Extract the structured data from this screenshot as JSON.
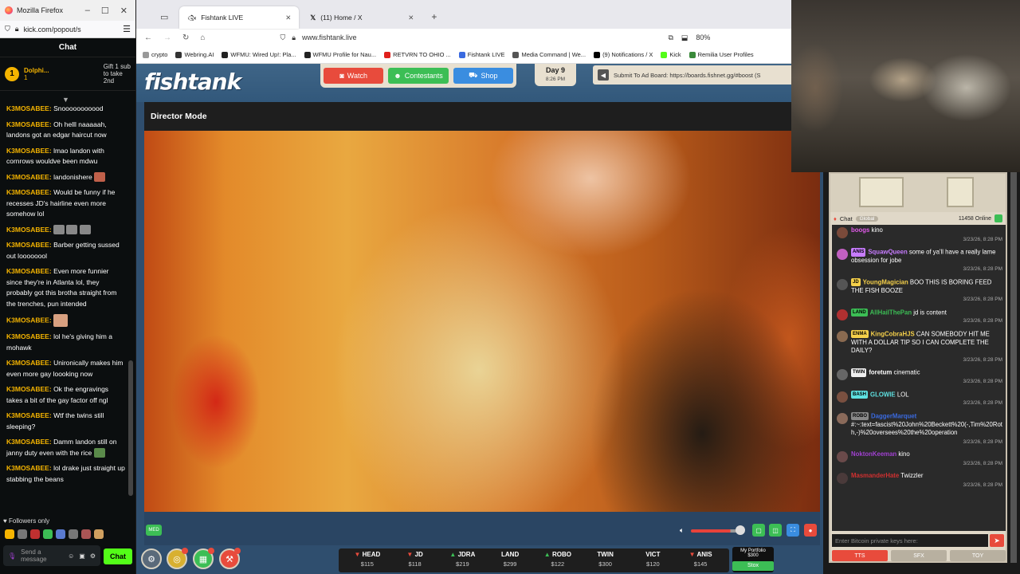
{
  "kick": {
    "window_title": "Mozilla Firefox",
    "url": "kick.com/popout/s",
    "chat_title": "Chat",
    "pinned": {
      "user": "Dolphi...",
      "rank": "1",
      "count": "1",
      "gift_line1": "Gift 1 sub",
      "gift_line2": "to take",
      "gift_line3": "2nd"
    },
    "messages": [
      {
        "user": "K3MOSABEE:",
        "text": "Snooooooooood"
      },
      {
        "user": "K3MOSABEE:",
        "text": "Oh helll naaaaah, landons got an edgar haircut now"
      },
      {
        "user": "K3MOSABEE:",
        "text": "lmao landon with cornrows wouldve been mdwu"
      },
      {
        "user": "K3MOSABEE:",
        "text": "landonishere"
      },
      {
        "user": "K3MOSABEE:",
        "text": "Would be funny if he recesses JD's hairline even more somehow lol"
      },
      {
        "user": "K3MOSABEE:",
        "text": ""
      },
      {
        "user": "K3MOSABEE:",
        "text": "Barber getting sussed out loooooool"
      },
      {
        "user": "K3MOSABEE:",
        "text": "Even more funnier since they're in Atlanta lol, they probably got this brotha straight from the trenches, pun intended"
      },
      {
        "user": "K3MOSABEE:",
        "text": ""
      },
      {
        "user": "K3MOSABEE:",
        "text": "lol he's giving him a mohawk"
      },
      {
        "user": "K3MOSABEE:",
        "text": "Unironically makes him even more gay loooking now"
      },
      {
        "user": "K3MOSABEE:",
        "text": "Ok the engravings takes a bit of the gay factor off ngl"
      },
      {
        "user": "K3MOSABEE:",
        "text": "Wtf the twins still sleeping?"
      },
      {
        "user": "K3MOSABEE:",
        "text": "Damm landon still on janny duty even with the rice"
      },
      {
        "user": "K3MOSABEE:",
        "text": "lol drake just straight up stabbing the beans"
      }
    ],
    "followers_only": "Followers only",
    "input_placeholder": "Send a message",
    "chat_button": "Chat"
  },
  "browser": {
    "tabs": [
      {
        "label": "Fishtank LIVE",
        "active": true
      },
      {
        "label": "(11) Home / X",
        "active": false
      }
    ],
    "new_tab": "+",
    "url": "www.fishtank.live",
    "zoom": "80%",
    "bookmarks": [
      "crypto",
      "Webring.AI",
      "WFMU: Wired Up!: Pla...",
      "WFMU Profile for Nau...",
      "RETVRN TO OHIO ...",
      "Fishtank LIVE",
      "Media Command | We...",
      "(9) Notifications / X",
      "Kick",
      "Remilia User Profiles"
    ]
  },
  "fishtank": {
    "logo": "fishtank",
    "nav": {
      "watch": "Watch",
      "contestants": "Contestants",
      "shop": "Shop"
    },
    "day": "Day 9",
    "time": "8:26 PM",
    "ad_text": "Submit To Ad Board: https://boards.fishnet.gg/#boost (S",
    "title": "Director Mode",
    "quality": "MED",
    "ticker": [
      {
        "name": "HEAD",
        "dir": "dn",
        "value": "115"
      },
      {
        "name": "JD",
        "dir": "dn",
        "value": "118"
      },
      {
        "name": "JDRA",
        "dir": "up",
        "value": "219"
      },
      {
        "name": "LAND",
        "dir": "none",
        "value": "299"
      },
      {
        "name": "ROBO",
        "dir": "up",
        "value": "122"
      },
      {
        "name": "TWIN",
        "dir": "none",
        "value": "300"
      },
      {
        "name": "VICT",
        "dir": "none",
        "value": "120"
      },
      {
        "name": "ANIS",
        "dir": "dn",
        "value": "145"
      }
    ],
    "portfolio": {
      "label": "My Portfolio",
      "value": "$300",
      "button": "Stox"
    },
    "colors": {
      "accent_red": "#e84b3c",
      "accent_green": "#3cbe55",
      "accent_blue": "#3a8de0"
    }
  },
  "rchat": {
    "title": "Chat",
    "scope": "Global",
    "online": "11458 Online",
    "messages": [
      {
        "tag": "",
        "user": "boogs",
        "text": "kino",
        "color": "#e05ae8",
        "ts": "3/23/26, 8:28 PM",
        "av": "#7a4a3a"
      },
      {
        "tag": "ANIS",
        "user": "SquawQueen",
        "text": "some of ya'll have a really lame obsession for jobe",
        "color": "#c77cff",
        "ts": "3/23/26, 8:28 PM",
        "av": "#c060c0"
      },
      {
        "tag": "JD",
        "user": "YoungMagician",
        "text": "BOO THIS IS BORING FEED THE FISH BOOZE",
        "color": "#f5d04a",
        "ts": "3/23/26, 8:28 PM",
        "av": "#555"
      },
      {
        "tag": "LAND",
        "user": "AllHailThePan",
        "text": "jd is content",
        "color": "#3cbe55",
        "ts": "3/23/26, 8:28 PM",
        "av": "#b03030"
      },
      {
        "tag": "ENMA",
        "user": "KingCobraHJS",
        "text": "CAN SOMEBODY HIT ME WITH A DOLLAR TIP SO I CAN COMPLETE THE DAILY?",
        "color": "#f5d04a",
        "ts": "3/23/26, 8:28 PM",
        "av": "#8a6a50"
      },
      {
        "tag": "TWIN",
        "user": "foretum",
        "text": "cinematic",
        "color": "#ffffff",
        "ts": "3/23/26, 8:28 PM",
        "av": "#666"
      },
      {
        "tag": "BASH",
        "user": "GLOWIE",
        "text": "LOL",
        "color": "#5ee0e0",
        "ts": "3/23/26, 8:28 PM",
        "av": "#7a5040"
      },
      {
        "tag": "ROBO",
        "user": "DaggerMarquet",
        "text": "#:~:text=fascist%20John%20Beckett%20(-,Tim%20Roth,-)%20oversees%20the%20operation",
        "color": "#3a6ae0",
        "ts": "3/23/26, 8:28 PM",
        "av": "#8a6a5a"
      },
      {
        "tag": "",
        "user": "NoktonKeeman",
        "text": "kino",
        "color": "#a040d0",
        "ts": "3/23/26, 8:28 PM",
        "av": "#6a4a4a"
      },
      {
        "tag": "",
        "user": "MasmanderHate",
        "text": "Twizzler",
        "color": "#d03030",
        "ts": "3/23/26, 8:28 PM",
        "av": "#4a3a3a"
      }
    ],
    "input_placeholder": "Enter Bitcoin private keys here:",
    "buttons": {
      "tts": "TTS",
      "sfx": "SFX",
      "toy": "TOY"
    }
  }
}
